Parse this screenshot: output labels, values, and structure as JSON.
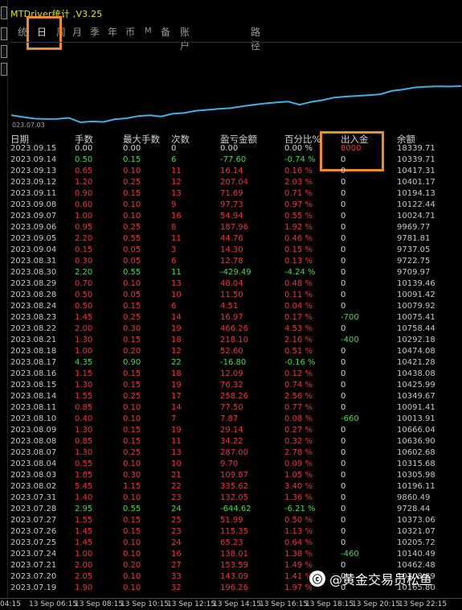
{
  "window": {
    "title": "MTDriver统计 ,V3.25"
  },
  "tabs": [
    "统",
    "日",
    "周",
    "月",
    "季",
    "年",
    "币",
    "M",
    "备",
    "账户",
    "路径"
  ],
  "equity_chart": {
    "start_date": "023.07.03",
    "line_color": "#3fb0e8",
    "points": [
      12.5,
      11.5,
      10.6,
      10.4,
      10.5,
      11.0,
      8.6,
      9.1,
      8.8,
      10.3,
      10.8,
      12.0,
      12.4,
      11.8,
      13.3,
      13.7,
      14.9,
      15.4,
      15.9,
      16.3,
      17.3,
      18.1,
      18.9,
      19.4,
      19.9,
      18.2,
      19.7,
      20.7,
      22.1,
      22.6,
      23.0,
      23.4,
      23.9,
      25.7,
      26.5,
      27.6,
      28.0,
      28.2,
      28.1,
      28.3
    ]
  },
  "table": {
    "headers": {
      "date": "日期",
      "lots": "手数",
      "max_lots": "最大手数",
      "count": "次数",
      "pnl": "盈亏金额",
      "pct": "百分比%",
      "funds": "出入金",
      "balance": "余额"
    },
    "rows": [
      {
        "date": "2023.09.15",
        "lots": "0.00",
        "max_lots": "0.00",
        "count": "0",
        "pnl": "0.00",
        "pct": "0.00 %",
        "funds": "8000",
        "balance": "18339.71",
        "tone": "white",
        "funds_tone": "red"
      },
      {
        "date": "2023.09.14",
        "lots": "0.50",
        "max_lots": "0.15",
        "count": "6",
        "pnl": "-77.60",
        "pct": "-0.74 %",
        "funds": "0",
        "balance": "10339.71",
        "tone": "green",
        "funds_tone": "white"
      },
      {
        "date": "2023.09.13",
        "lots": "0.65",
        "max_lots": "0.10",
        "count": "11",
        "pnl": "16.14",
        "pct": "0.16 %",
        "funds": "0",
        "balance": "10417.31",
        "tone": "red",
        "funds_tone": "white"
      },
      {
        "date": "2023.09.12",
        "lots": "1.20",
        "max_lots": "0.25",
        "count": "12",
        "pnl": "207.04",
        "pct": "2.03 %",
        "funds": "0",
        "balance": "10401.17",
        "tone": "red",
        "funds_tone": "white"
      },
      {
        "date": "2023.09.11",
        "lots": "0.90",
        "max_lots": "0.15",
        "count": "13",
        "pnl": "71.69",
        "pct": "0.71 %",
        "funds": "0",
        "balance": "10194.13",
        "tone": "red",
        "funds_tone": "white"
      },
      {
        "date": "2023.09.08",
        "lots": "0.60",
        "max_lots": "0.10",
        "count": "9",
        "pnl": "97.73",
        "pct": "0.97 %",
        "funds": "0",
        "balance": "10122.44",
        "tone": "red",
        "funds_tone": "white"
      },
      {
        "date": "2023.09.07",
        "lots": "1.00",
        "max_lots": "0.10",
        "count": "16",
        "pnl": "54.94",
        "pct": "0.55 %",
        "funds": "0",
        "balance": "10024.71",
        "tone": "red",
        "funds_tone": "white"
      },
      {
        "date": "2023.09.06",
        "lots": "0.95",
        "max_lots": "0.25",
        "count": "8",
        "pnl": "187.96",
        "pct": "1.92 %",
        "funds": "0",
        "balance": "9969.77",
        "tone": "red",
        "funds_tone": "white"
      },
      {
        "date": "2023.09.05",
        "lots": "2.20",
        "max_lots": "0.55",
        "count": "11",
        "pnl": "44.76",
        "pct": "0.46 %",
        "funds": "0",
        "balance": "9781.81",
        "tone": "red",
        "funds_tone": "white"
      },
      {
        "date": "2023.09.04",
        "lots": "0.15",
        "max_lots": "0.05",
        "count": "3",
        "pnl": "14.30",
        "pct": "0.15 %",
        "funds": "0",
        "balance": "9737.05",
        "tone": "red",
        "funds_tone": "white"
      },
      {
        "date": "2023.08.31",
        "lots": "0.30",
        "max_lots": "0.05",
        "count": "6",
        "pnl": "12.78",
        "pct": "0.13 %",
        "funds": "0",
        "balance": "9722.75",
        "tone": "red",
        "funds_tone": "white"
      },
      {
        "date": "2023.08.30",
        "lots": "2.20",
        "max_lots": "0.55",
        "count": "11",
        "pnl": "-429.49",
        "pct": "-4.24 %",
        "funds": "0",
        "balance": "9709.97",
        "tone": "green",
        "funds_tone": "white"
      },
      {
        "date": "2023.08.29",
        "lots": "0.70",
        "max_lots": "0.10",
        "count": "13",
        "pnl": "48.04",
        "pct": "0.48 %",
        "funds": "0",
        "balance": "10139.46",
        "tone": "red",
        "funds_tone": "white"
      },
      {
        "date": "2023.08.28",
        "lots": "0.50",
        "max_lots": "0.05",
        "count": "10",
        "pnl": "11.50",
        "pct": "0.11 %",
        "funds": "0",
        "balance": "10091.42",
        "tone": "red",
        "funds_tone": "white"
      },
      {
        "date": "2023.08.24",
        "lots": "0.50",
        "max_lots": "0.15",
        "count": "6",
        "pnl": "4.51",
        "pct": "0.04 %",
        "funds": "0",
        "balance": "10079.92",
        "tone": "red",
        "funds_tone": "white"
      },
      {
        "date": "2023.08.23",
        "lots": "1.45",
        "max_lots": "0.25",
        "count": "14",
        "pnl": "16.97",
        "pct": "0.17 %",
        "funds": "-700",
        "balance": "10075.41",
        "tone": "red",
        "funds_tone": "green"
      },
      {
        "date": "2023.08.22",
        "lots": "2.00",
        "max_lots": "0.30",
        "count": "19",
        "pnl": "466.26",
        "pct": "4.53 %",
        "funds": "0",
        "balance": "10758.44",
        "tone": "red",
        "funds_tone": "white"
      },
      {
        "date": "2023.08.21",
        "lots": "1.30",
        "max_lots": "0.15",
        "count": "18",
        "pnl": "218.10",
        "pct": "2.16 %",
        "funds": "-400",
        "balance": "10292.18",
        "tone": "red",
        "funds_tone": "green"
      },
      {
        "date": "2023.08.18",
        "lots": "1.00",
        "max_lots": "0.20",
        "count": "12",
        "pnl": "52.60",
        "pct": "0.51 %",
        "funds": "0",
        "balance": "10474.08",
        "tone": "red",
        "funds_tone": "white"
      },
      {
        "date": "2023.08.17",
        "lots": "4.35",
        "max_lots": "0.90",
        "count": "22",
        "pnl": "-16.80",
        "pct": "-0.16 %",
        "funds": "0",
        "balance": "10421.28",
        "tone": "green",
        "funds_tone": "white"
      },
      {
        "date": "2023.08.16",
        "lots": "1.15",
        "max_lots": "0.15",
        "count": "18",
        "pnl": "12.09",
        "pct": "0.12 %",
        "funds": "0",
        "balance": "10438.08",
        "tone": "red",
        "funds_tone": "white"
      },
      {
        "date": "2023.08.15",
        "lots": "1.30",
        "max_lots": "0.15",
        "count": "19",
        "pnl": "76.32",
        "pct": "0.74 %",
        "funds": "0",
        "balance": "10425.99",
        "tone": "red",
        "funds_tone": "white"
      },
      {
        "date": "2023.08.14",
        "lots": "1.55",
        "max_lots": "0.25",
        "count": "17",
        "pnl": "258.26",
        "pct": "2.56 %",
        "funds": "0",
        "balance": "10349.67",
        "tone": "red",
        "funds_tone": "white"
      },
      {
        "date": "2023.08.11",
        "lots": "0.85",
        "max_lots": "0.10",
        "count": "14",
        "pnl": "77.50",
        "pct": "0.77 %",
        "funds": "0",
        "balance": "10091.41",
        "tone": "red",
        "funds_tone": "white"
      },
      {
        "date": "2023.08.10",
        "lots": "0.40",
        "max_lots": "0.10",
        "count": "7",
        "pnl": "7.87",
        "pct": "0.08 %",
        "funds": "-660",
        "balance": "10013.91",
        "tone": "red",
        "funds_tone": "green"
      },
      {
        "date": "2023.08.09",
        "lots": "1.30",
        "max_lots": "0.15",
        "count": "19",
        "pnl": "29.14",
        "pct": "0.27 %",
        "funds": "0",
        "balance": "10666.04",
        "tone": "red",
        "funds_tone": "white"
      },
      {
        "date": "2023.08.08",
        "lots": "0.85",
        "max_lots": "0.15",
        "count": "11",
        "pnl": "34.22",
        "pct": "0.32 %",
        "funds": "0",
        "balance": "10636.90",
        "tone": "red",
        "funds_tone": "white"
      },
      {
        "date": "2023.08.07",
        "lots": "1.30",
        "max_lots": "0.25",
        "count": "13",
        "pnl": "287.00",
        "pct": "2.78 %",
        "funds": "0",
        "balance": "10602.68",
        "tone": "red",
        "funds_tone": "white"
      },
      {
        "date": "2023.08.04",
        "lots": "0.55",
        "max_lots": "0.10",
        "count": "10",
        "pnl": "9.70",
        "pct": "0.09 %",
        "funds": "0",
        "balance": "10315.68",
        "tone": "red",
        "funds_tone": "white"
      },
      {
        "date": "2023.08.03",
        "lots": "1.85",
        "max_lots": "0.30",
        "count": "21",
        "pnl": "109.87",
        "pct": "1.05 %",
        "funds": "0",
        "balance": "10305.98",
        "tone": "red",
        "funds_tone": "white"
      },
      {
        "date": "2023.08.02",
        "lots": "5.45",
        "max_lots": "1.15",
        "count": "22",
        "pnl": "335.62",
        "pct": "3.40 %",
        "funds": "0",
        "balance": "10196.11",
        "tone": "red",
        "funds_tone": "white"
      },
      {
        "date": "2023.07.31",
        "lots": "1.40",
        "max_lots": "0.10",
        "count": "23",
        "pnl": "132.05",
        "pct": "1.36 %",
        "funds": "0",
        "balance": "9860.49",
        "tone": "red",
        "funds_tone": "white"
      },
      {
        "date": "2023.07.28",
        "lots": "2.95",
        "max_lots": "0.55",
        "count": "24",
        "pnl": "-644.62",
        "pct": "-6.21 %",
        "funds": "0",
        "balance": "9728.44",
        "tone": "green",
        "funds_tone": "white"
      },
      {
        "date": "2023.07.27",
        "lots": "1.55",
        "max_lots": "0.15",
        "count": "25",
        "pnl": "51.99",
        "pct": "0.50 %",
        "funds": "0",
        "balance": "10373.06",
        "tone": "red",
        "funds_tone": "white"
      },
      {
        "date": "2023.07.26",
        "lots": "1.45",
        "max_lots": "0.15",
        "count": "23",
        "pnl": "115.35",
        "pct": "1.13 %",
        "funds": "0",
        "balance": "10321.07",
        "tone": "red",
        "funds_tone": "white"
      },
      {
        "date": "2023.07.25",
        "lots": "1.45",
        "max_lots": "0.10",
        "count": "24",
        "pnl": "65.23",
        "pct": "0.64 %",
        "funds": "0",
        "balance": "10205.72",
        "tone": "red",
        "funds_tone": "white"
      },
      {
        "date": "2023.07.24",
        "lots": "1.00",
        "max_lots": "0.10",
        "count": "16",
        "pnl": "138.01",
        "pct": "1.38 %",
        "funds": "-460",
        "balance": "10140.49",
        "tone": "red",
        "funds_tone": "green"
      },
      {
        "date": "2023.07.21",
        "lots": "2.00",
        "max_lots": "0.20",
        "count": "27",
        "pnl": "153.59",
        "pct": "1.49 %",
        "funds": "0",
        "balance": "10462.48",
        "tone": "red",
        "funds_tone": "white"
      },
      {
        "date": "2023.07.20",
        "lots": "2.05",
        "max_lots": "0.10",
        "count": "33",
        "pnl": "143.09",
        "pct": "1.41 %",
        "funds": "0",
        "balance": "10308.89",
        "tone": "red",
        "funds_tone": "white"
      },
      {
        "date": "2023.07.19",
        "lots": "1.90",
        "max_lots": "0.10",
        "count": "32",
        "pnl": "196.26",
        "pct": "1.97 %",
        "funds": "0",
        "balance": "10165.80",
        "tone": "red",
        "funds_tone": "white"
      }
    ]
  },
  "watermark": "@黄金交易员松鱼",
  "time_axis": [
    "04:15",
    "13 Sep 06:15",
    "13 Sep 08:15",
    "13 Sep 10:15",
    "13 Sep 12:15",
    "13 Sep 14:15",
    "13 Sep 16:15",
    "13 Sep 18:15",
    "13 Sep 20:15",
    "13 Sep 22:15"
  ],
  "colors": {
    "accent_box": "#f08a2a",
    "loss": "#4fd84f",
    "profit": "#e23b3b",
    "title": "#e8e800",
    "equity_line": "#3fb0e8"
  }
}
